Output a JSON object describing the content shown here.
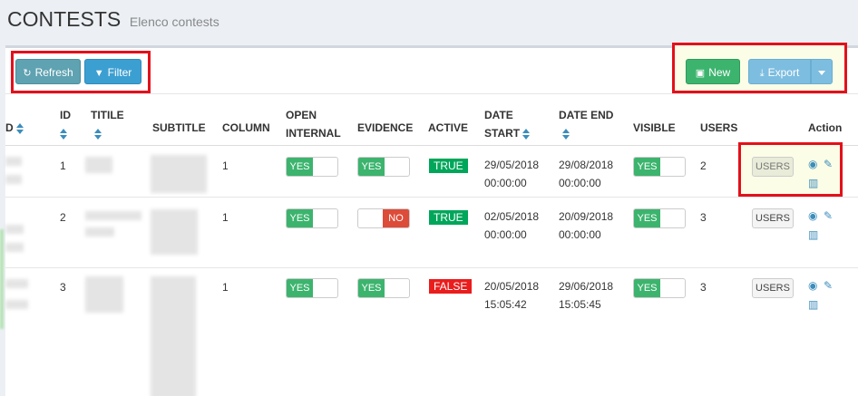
{
  "header": {
    "title": "CONTESTS",
    "subtitle": "Elenco contests"
  },
  "toolbar": {
    "refresh_label": "Refresh",
    "filter_label": "Filter",
    "new_label": "New",
    "export_label": "Export"
  },
  "icons": {
    "refresh": "refresh-icon",
    "filter": "filter-icon",
    "new": "save-icon",
    "export": "download-icon",
    "view": "eye-icon",
    "edit": "edit-icon",
    "delete": "trash-icon"
  },
  "colors": {
    "toggle_on": "#3cb46e",
    "toggle_off": "#dd4b39",
    "badge_true": "#00a65a",
    "badge_false": "#ea1c1c",
    "link": "#3c8dbc",
    "highlight": "#e3101b"
  },
  "table": {
    "columns": {
      "d": "D",
      "id": "ID",
      "titile": "TITILE",
      "subtitle": "SUBTITLE",
      "column": "COLUMN",
      "open_internal_1": "OPEN",
      "open_internal_2": "INTERNAL",
      "evidence": "EVIDENCE",
      "active": "ACTIVE",
      "date_start_1": "DATE",
      "date_start_2": "START",
      "date_end": "DATE END",
      "visible": "VISIBLE",
      "users": "USERS",
      "action": "Action"
    },
    "rows": [
      {
        "id": "1",
        "column": "1",
        "open_internal": "YES",
        "evidence": "YES",
        "active": "TRUE",
        "date_start_date": "29/05/2018",
        "date_start_time": "00:00:00",
        "date_end_date": "29/08/2018",
        "date_end_time": "00:00:00",
        "visible": "YES",
        "users": "2",
        "users_button": "USERS"
      },
      {
        "id": "2",
        "column": "1",
        "open_internal": "YES",
        "evidence": "NO",
        "active": "TRUE",
        "date_start_date": "02/05/2018",
        "date_start_time": "00:00:00",
        "date_end_date": "20/09/2018",
        "date_end_time": "00:00:00",
        "visible": "YES",
        "users": "3",
        "users_button": "USERS"
      },
      {
        "id": "3",
        "column": "1",
        "open_internal": "YES",
        "evidence": "YES",
        "active": "FALSE",
        "date_start_date": "20/05/2018",
        "date_start_time": "15:05:42",
        "date_end_date": "29/06/2018",
        "date_end_time": "15:05:45",
        "visible": "YES",
        "users": "3",
        "users_button": "USERS"
      }
    ]
  }
}
